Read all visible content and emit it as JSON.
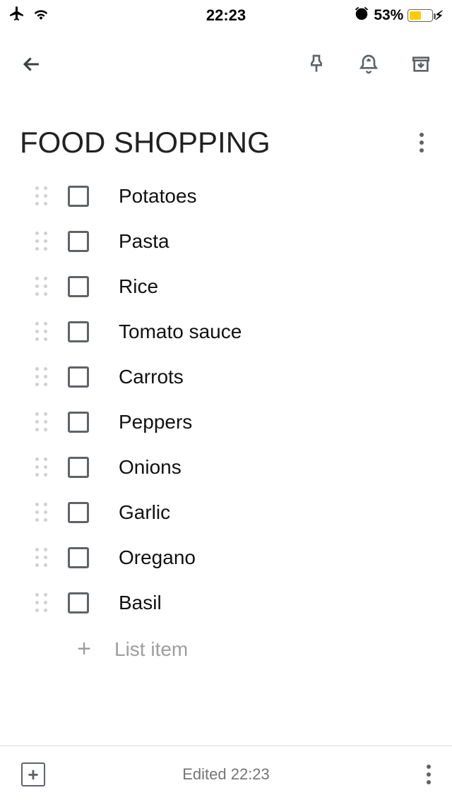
{
  "status": {
    "time": "22:23",
    "battery_percent": "53%"
  },
  "note": {
    "title": "FOOD SHOPPING",
    "items": [
      {
        "label": "Potatoes"
      },
      {
        "label": "Pasta"
      },
      {
        "label": "Rice"
      },
      {
        "label": "Tomato sauce"
      },
      {
        "label": "Carrots"
      },
      {
        "label": "Peppers"
      },
      {
        "label": "Onions"
      },
      {
        "label": "Garlic"
      },
      {
        "label": "Oregano"
      },
      {
        "label": "Basil"
      }
    ],
    "new_item_placeholder": "List item"
  },
  "footer": {
    "edited": "Edited 22:23"
  }
}
